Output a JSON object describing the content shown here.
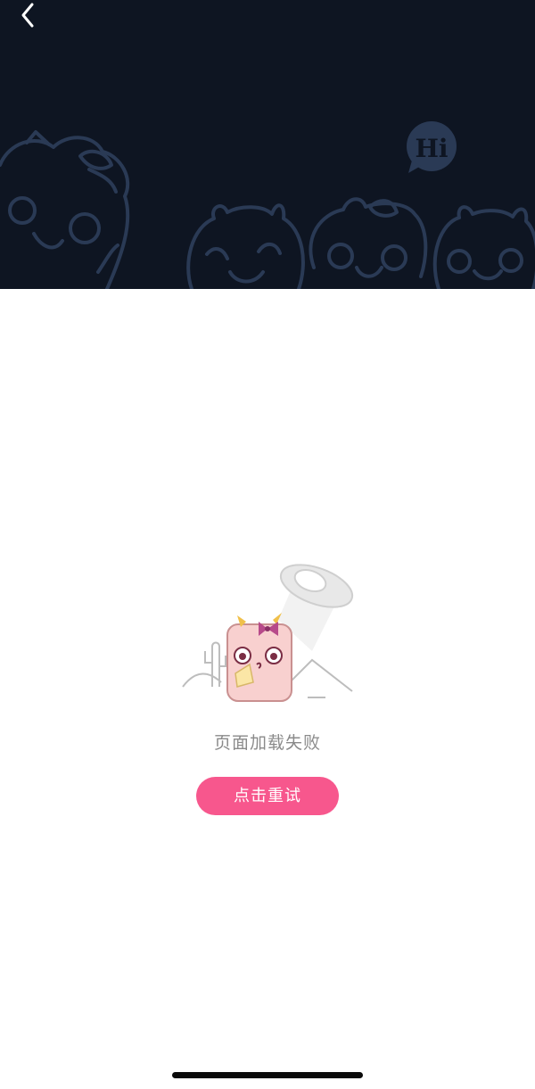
{
  "header": {
    "badge_text": "Hi",
    "icons": {
      "back": "chevron-left-icon"
    },
    "colors": {
      "background": "#0e1522",
      "line_art": "#2a3a55"
    }
  },
  "main": {
    "error_message": "页面加载失败",
    "retry_label": "点击重试",
    "colors": {
      "button": "#f7578d",
      "text": "#8a8a8a"
    }
  }
}
